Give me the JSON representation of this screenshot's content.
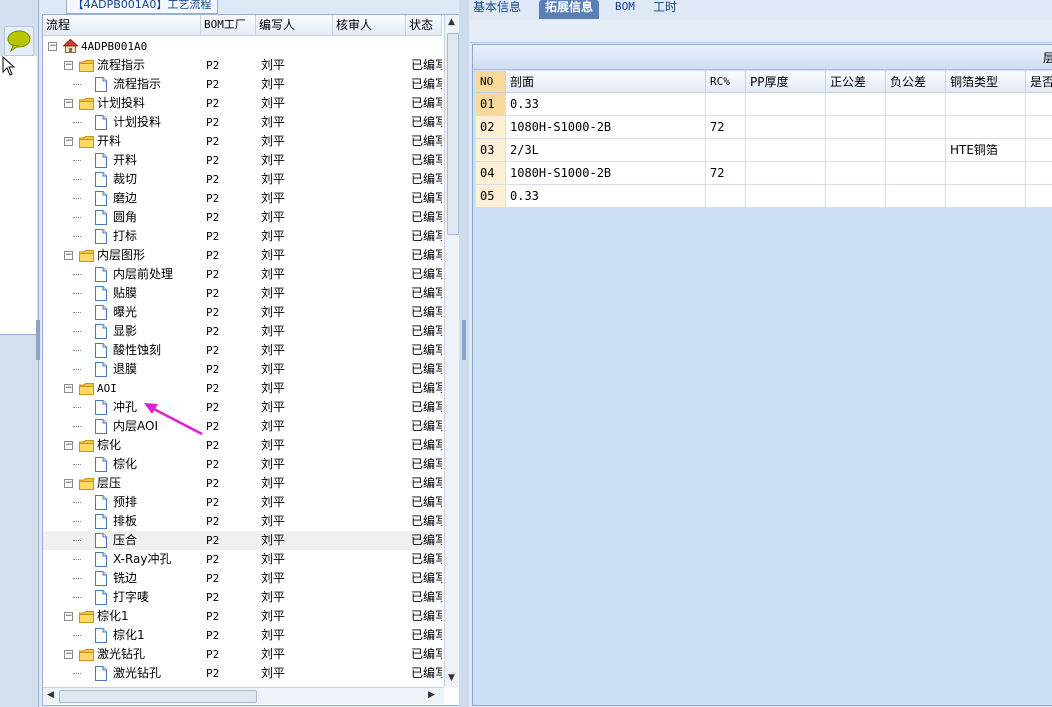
{
  "window": {
    "title_tab": "【4ADPB001A0】工艺流程"
  },
  "tree": {
    "columns": {
      "process": "流程",
      "bom_factory": "BOM工厂",
      "writer": "编写人",
      "reviewer": "核审人",
      "status": "状态"
    },
    "rows": [
      {
        "depth": 0,
        "kind": "root",
        "label": "4ADPB001A0",
        "mono": true,
        "bom": "",
        "writer": "",
        "status": ""
      },
      {
        "depth": 1,
        "kind": "folder",
        "label": "流程指示",
        "bom": "P2",
        "writer": "刘平",
        "status": "已编写"
      },
      {
        "depth": 2,
        "kind": "file",
        "label": "流程指示",
        "bom": "P2",
        "writer": "刘平",
        "status": "已编写"
      },
      {
        "depth": 1,
        "kind": "folder",
        "label": "计划投料",
        "bom": "P2",
        "writer": "刘平",
        "status": "已编写"
      },
      {
        "depth": 2,
        "kind": "file",
        "label": "计划投料",
        "bom": "P2",
        "writer": "刘平",
        "status": "已编写"
      },
      {
        "depth": 1,
        "kind": "folder",
        "label": "开料",
        "bom": "P2",
        "writer": "刘平",
        "status": "已编写"
      },
      {
        "depth": 2,
        "kind": "file",
        "label": "开料",
        "bom": "P2",
        "writer": "刘平",
        "status": "已编写"
      },
      {
        "depth": 2,
        "kind": "file",
        "label": "裁切",
        "bom": "P2",
        "writer": "刘平",
        "status": "已编写"
      },
      {
        "depth": 2,
        "kind": "file",
        "label": "磨边",
        "bom": "P2",
        "writer": "刘平",
        "status": "已编写"
      },
      {
        "depth": 2,
        "kind": "file",
        "label": "圆角",
        "bom": "P2",
        "writer": "刘平",
        "status": "已编写"
      },
      {
        "depth": 2,
        "kind": "file",
        "label": "打标",
        "bom": "P2",
        "writer": "刘平",
        "status": "已编写"
      },
      {
        "depth": 1,
        "kind": "folder",
        "label": "内层图形",
        "bom": "P2",
        "writer": "刘平",
        "status": "已编写"
      },
      {
        "depth": 2,
        "kind": "file",
        "label": "内层前处理",
        "bom": "P2",
        "writer": "刘平",
        "status": "已编写"
      },
      {
        "depth": 2,
        "kind": "file",
        "label": "贴膜",
        "bom": "P2",
        "writer": "刘平",
        "status": "已编写"
      },
      {
        "depth": 2,
        "kind": "file",
        "label": "曝光",
        "bom": "P2",
        "writer": "刘平",
        "status": "已编写"
      },
      {
        "depth": 2,
        "kind": "file",
        "label": "显影",
        "bom": "P2",
        "writer": "刘平",
        "status": "已编写"
      },
      {
        "depth": 2,
        "kind": "file",
        "label": "酸性蚀刻",
        "bom": "P2",
        "writer": "刘平",
        "status": "已编写"
      },
      {
        "depth": 2,
        "kind": "file",
        "label": "退膜",
        "bom": "P2",
        "writer": "刘平",
        "status": "已编写"
      },
      {
        "depth": 1,
        "kind": "folder",
        "label": "AOI",
        "mono": true,
        "bom": "P2",
        "writer": "刘平",
        "status": "已编写"
      },
      {
        "depth": 2,
        "kind": "file",
        "label": "冲孔",
        "bom": "P2",
        "writer": "刘平",
        "status": "已编写"
      },
      {
        "depth": 2,
        "kind": "file",
        "label": "内层AOI",
        "bom": "P2",
        "writer": "刘平",
        "status": "已编写"
      },
      {
        "depth": 1,
        "kind": "folder",
        "label": "棕化",
        "bom": "P2",
        "writer": "刘平",
        "status": "已编写"
      },
      {
        "depth": 2,
        "kind": "file",
        "label": "棕化",
        "bom": "P2",
        "writer": "刘平",
        "status": "已编写"
      },
      {
        "depth": 1,
        "kind": "folder",
        "label": "层压",
        "bom": "P2",
        "writer": "刘平",
        "status": "已编写"
      },
      {
        "depth": 2,
        "kind": "file",
        "label": "预排",
        "bom": "P2",
        "writer": "刘平",
        "status": "已编写"
      },
      {
        "depth": 2,
        "kind": "file",
        "label": "排板",
        "bom": "P2",
        "writer": "刘平",
        "status": "已编写"
      },
      {
        "depth": 2,
        "kind": "file",
        "label": "压合",
        "bom": "P2",
        "writer": "刘平",
        "status": "已编写",
        "selected": true
      },
      {
        "depth": 2,
        "kind": "file",
        "label": "X-Ray冲孔",
        "bom": "P2",
        "writer": "刘平",
        "status": "已编写"
      },
      {
        "depth": 2,
        "kind": "file",
        "label": "铣边",
        "bom": "P2",
        "writer": "刘平",
        "status": "已编写"
      },
      {
        "depth": 2,
        "kind": "file",
        "label": "打字唛",
        "bom": "P2",
        "writer": "刘平",
        "status": "已编写"
      },
      {
        "depth": 1,
        "kind": "folder",
        "label": "棕化1",
        "bom": "P2",
        "writer": "刘平",
        "status": "已编写"
      },
      {
        "depth": 2,
        "kind": "file",
        "label": "棕化1",
        "bom": "P2",
        "writer": "刘平",
        "status": "已编写"
      },
      {
        "depth": 1,
        "kind": "folder",
        "label": "激光钻孔",
        "bom": "P2",
        "writer": "刘平",
        "status": "已编写"
      },
      {
        "depth": 2,
        "kind": "file",
        "label": "激光钻孔",
        "bom": "P2",
        "writer": "刘平",
        "status": "已编写"
      }
    ]
  },
  "tabs": [
    {
      "label": "基本信息",
      "active": false
    },
    {
      "label": "拓展信息",
      "active": true
    },
    {
      "label": "BOM",
      "active": false
    },
    {
      "label": "工时",
      "active": false
    }
  ],
  "panel": {
    "header_text": "层"
  },
  "grid": {
    "columns": {
      "no": "NO",
      "section": "剖面",
      "rc": "RC%",
      "pp": "PP厚度",
      "pos_tol": "正公差",
      "neg_tol": "负公差",
      "copper": "铜箔类型",
      "is": "是否"
    },
    "rows": [
      {
        "no": "01",
        "section": "0.33",
        "rc": "",
        "pp": "",
        "pos_tol": "",
        "neg_tol": "",
        "copper": ""
      },
      {
        "no": "02",
        "section": "1080H-S1000-2B",
        "rc": "72",
        "pp": "",
        "pos_tol": "",
        "neg_tol": "",
        "copper": ""
      },
      {
        "no": "03",
        "section": "2/3L",
        "rc": "",
        "pp": "",
        "pos_tol": "",
        "neg_tol": "",
        "copper": "HTE铜箔"
      },
      {
        "no": "04",
        "section": "1080H-S1000-2B",
        "rc": "72",
        "pp": "",
        "pos_tol": "",
        "neg_tol": "",
        "copper": ""
      },
      {
        "no": "05",
        "section": "0.33",
        "rc": "",
        "pp": "",
        "pos_tol": "",
        "neg_tol": "",
        "copper": ""
      }
    ]
  },
  "colors": {
    "annotation_arrow": "#e020d0",
    "accent": "#5a7fb6"
  },
  "icons": {
    "chat": "speech-bubble-icon",
    "cursor": "mouse-pointer-icon",
    "root": "home-icon",
    "folder": "folder-icon",
    "file": "document-icon"
  }
}
